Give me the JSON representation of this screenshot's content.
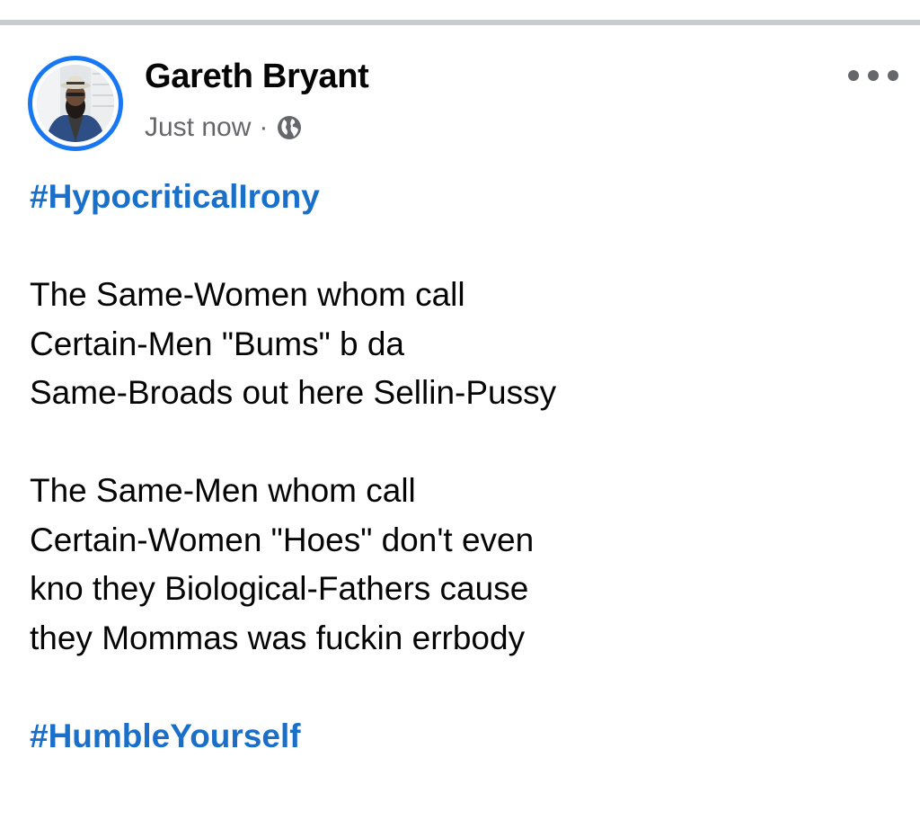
{
  "post": {
    "author": "Gareth Bryant",
    "timestamp": "Just now",
    "separator": "·",
    "privacy_icon": "globe-icon",
    "menu_icon": "more-options-icon",
    "hashtag_top": "#HypocriticalIrony",
    "paragraph_1": [
      "The Same-Women whom call",
      "Certain-Men \"Bums\" b da",
      "Same-Broads out here Sellin-Pussy"
    ],
    "paragraph_2": [
      "The Same-Men whom call",
      "Certain-Women \"Hoes\" don't even",
      "kno they Biological-Fathers cause",
      "they Mommas was fuckin errbody"
    ],
    "hashtag_bottom": "#HumbleYourself"
  },
  "colors": {
    "avatar_ring": "#1877f2",
    "hashtag": "#1a6fc9",
    "text": "#050505",
    "secondary_text": "#65676b",
    "divider": "#c9cccf"
  }
}
